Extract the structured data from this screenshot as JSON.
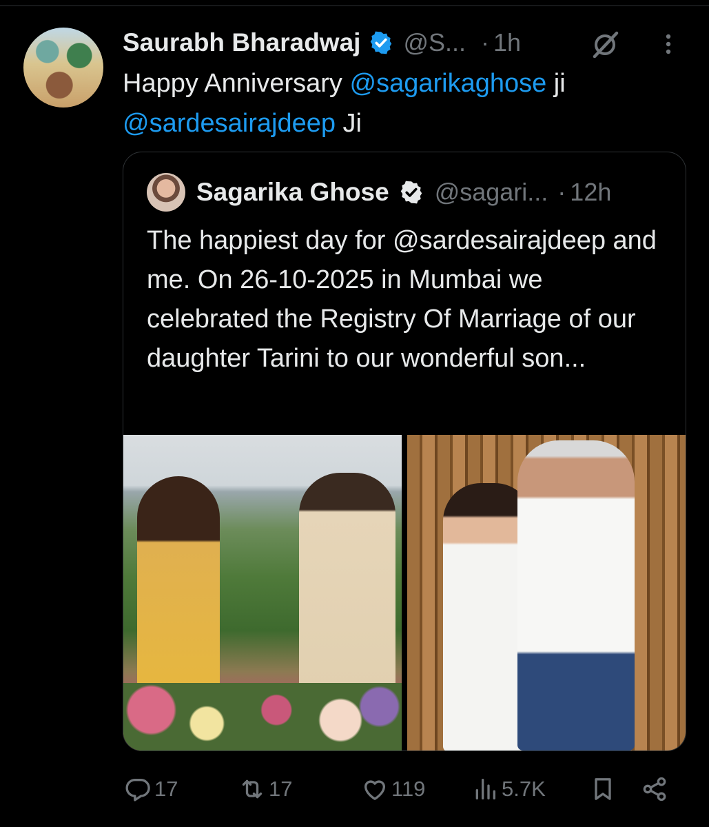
{
  "tweet": {
    "author_name": "Saurabh Bharadwaj",
    "handle": "@S...",
    "separator": "·",
    "time": "1h",
    "text_parts": {
      "t1": "Happy Anniversary ",
      "m1": "@sagarikaghose",
      "t2": " ji ",
      "m2": "@sardesairajdeep",
      "t3": " Ji"
    }
  },
  "quote": {
    "author_name": "Sagarika Ghose",
    "handle": "@sagari...",
    "separator": "·",
    "time": "12h",
    "text": "The happiest day for @sardesairajdeep and me. On 26-10-2025 in Mumbai we celebrated the Registry Of Marriage of our daughter Tarini to our wonderful son..."
  },
  "actions": {
    "replies": "17",
    "reposts": "17",
    "likes": "119",
    "views": "5.7K"
  },
  "colors": {
    "background": "#000000",
    "text": "#e7e9ea",
    "muted": "#71767b",
    "link": "#1d9bf0",
    "verified": "#1d9bf0",
    "border": "#2f3336"
  },
  "icons": [
    "verified-badge-icon",
    "grok-icon",
    "more-icon",
    "reply-icon",
    "repost-icon",
    "like-icon",
    "views-icon",
    "bookmark-icon",
    "share-icon"
  ]
}
